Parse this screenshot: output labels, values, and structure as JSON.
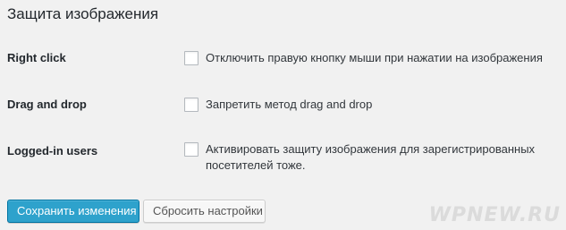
{
  "section": {
    "title": "Защита изображения"
  },
  "rows": [
    {
      "label": "Right click",
      "description": "Отключить правую кнопку мыши при нажатии на изображения",
      "checked": false
    },
    {
      "label": "Drag and drop",
      "description": "Запретить метод drag and drop",
      "checked": false
    },
    {
      "label": "Logged-in users",
      "description": "Активировать защиту изображения для зарегистрированных посетителей тоже.",
      "checked": false
    }
  ],
  "buttons": {
    "save_label": "Сохранить изменения",
    "reset_label": "Сбросить настройки"
  },
  "colors": {
    "primary_button": "#2ea2cc",
    "page_background": "#f1f1f1"
  },
  "watermark": {
    "text": "WPNEW.RU"
  }
}
